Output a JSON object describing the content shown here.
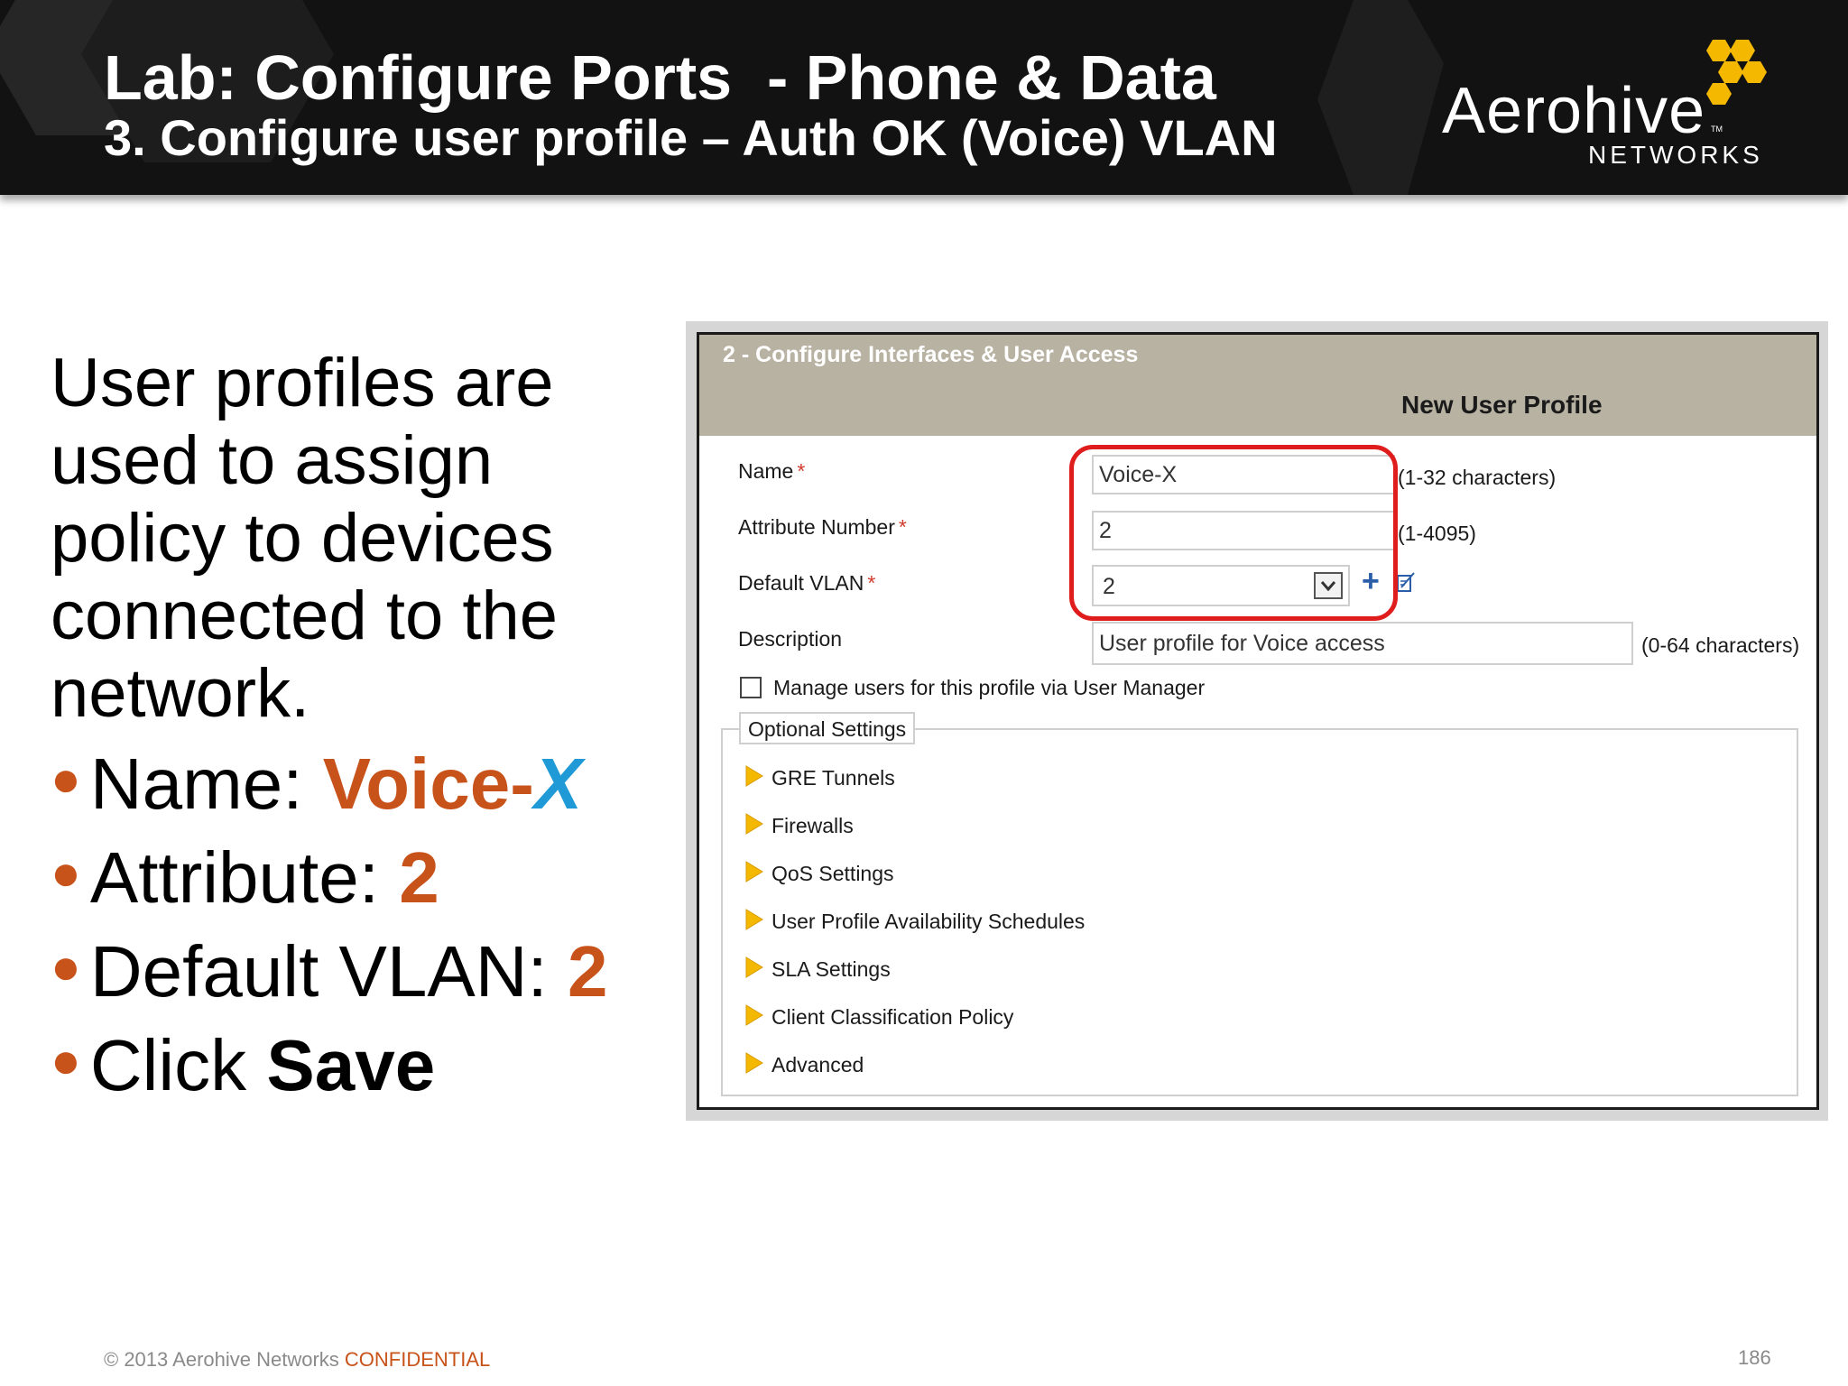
{
  "header": {
    "title": "Lab: Configure Ports  - Phone & Data",
    "subtitle": "3. Configure user profile – Auth OK (Voice) VLAN",
    "logo": {
      "word": "Aerohive",
      "tm": "TM",
      "sub": "NETWORKS"
    }
  },
  "content": {
    "intro": "User profiles are used to assign policy to devices connected to the network.",
    "bullets": {
      "name": {
        "label": "Name: ",
        "value_prefix": "Voice-",
        "value_suffix": "X"
      },
      "attribute": {
        "label": "Attribute: ",
        "value": "2"
      },
      "vlan": {
        "label": "Default VLAN: ",
        "value": "2"
      },
      "save": {
        "label": "Click ",
        "value": "Save"
      }
    }
  },
  "screenshot": {
    "step_title": "2 - Configure Interfaces & User Access",
    "form_title": "New User Profile",
    "fields": {
      "name": {
        "label": "Name",
        "required": "*",
        "value": "Voice-X",
        "hint": "(1-32 characters)"
      },
      "attribute": {
        "label": "Attribute Number",
        "required": "*",
        "value": "2",
        "hint": "(1-4095)"
      },
      "vlan": {
        "label": "Default VLAN",
        "required": "*",
        "value": "2"
      },
      "description": {
        "label": "Description",
        "value": "User profile for Voice access",
        "hint": "(0-64 characters)"
      }
    },
    "user_manager_label": "Manage users for this profile via User Manager",
    "optional_settings": {
      "title": "Optional Settings",
      "items": [
        "GRE Tunnels",
        "Firewalls",
        "QoS Settings",
        "User Profile Availability Schedules",
        "SLA Settings",
        "Client Classification Policy",
        "Advanced"
      ]
    }
  },
  "footer": {
    "copyright": "© 2013 Aerohive Networks ",
    "confidential": "CONFIDENTIAL",
    "page": "186"
  },
  "colors": {
    "header_bg": "#121212",
    "accent_orange": "#c8531a",
    "accent_blue": "#1f9ad6",
    "logo_yellow": "#f5b800",
    "highlight_red": "#e01d1d",
    "panel_header": "#b8b2a3",
    "expander_triangle": "#f5b800"
  },
  "icons": {
    "logo": "honeycomb-logo-icon",
    "add": "plus-icon",
    "edit": "edit-icon",
    "dropdown": "chevron-down-icon",
    "expander": "triangle-right-icon"
  }
}
